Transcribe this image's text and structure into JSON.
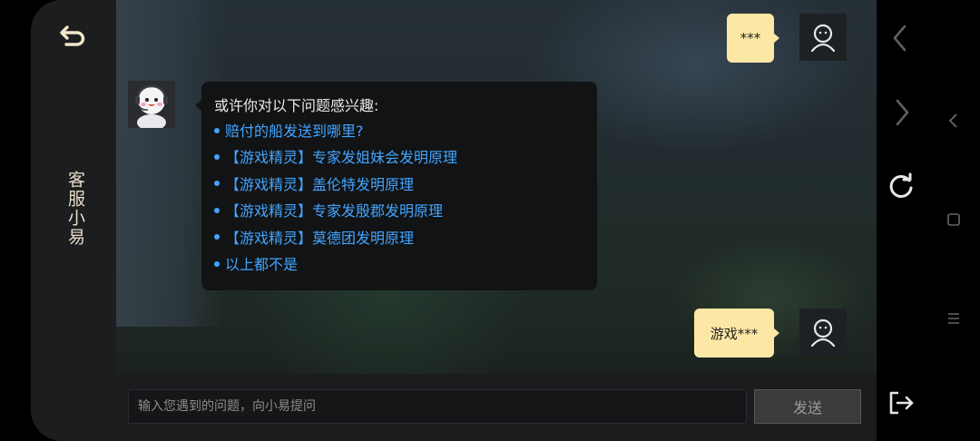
{
  "panel": {
    "title": "客服小易",
    "back_icon": "back-arrow-icon"
  },
  "messages": [
    {
      "role": "user",
      "text": "***"
    },
    {
      "role": "bot",
      "heading": "或许你对以下问题感兴趣:",
      "suggestions": [
        "赔付的船发送到哪里?",
        "【游戏精灵】专家发姐妹会发明原理",
        "【游戏精灵】盖伦特发明原理",
        "【游戏精灵】专家发殷郡发明原理",
        "【游戏精灵】莫德团发明原理",
        "以上都不是"
      ]
    },
    {
      "role": "user",
      "text": "游戏***"
    }
  ],
  "input": {
    "placeholder": "输入您遇到的问题，向小易提问",
    "value": ""
  },
  "send_label": "发送",
  "nav": {
    "prev_icon": "chevron-left-icon",
    "next_icon": "chevron-right-icon",
    "refresh_icon": "refresh-icon",
    "exit_icon": "exit-icon"
  },
  "colors": {
    "user_bubble": "#fde7a5",
    "bot_bubble": "#121314",
    "link": "#42a4ff",
    "title": "#e6dcc8"
  }
}
